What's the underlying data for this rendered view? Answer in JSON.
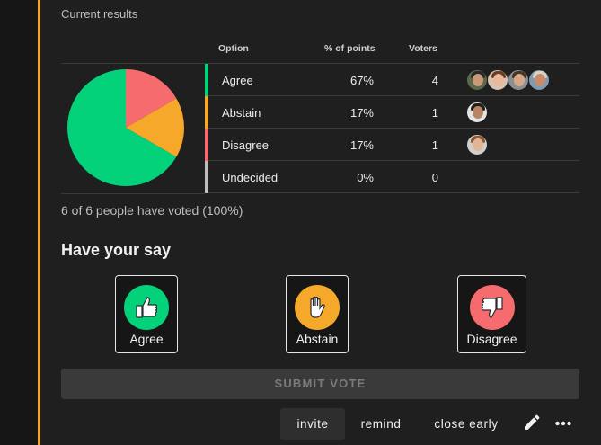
{
  "results": {
    "title": "Current results",
    "headers": {
      "option": "Option",
      "percent": "% of points",
      "voters": "Voters"
    },
    "rows": [
      {
        "option": "Agree",
        "percent": "67%",
        "voters": "4",
        "color": "#04d27b",
        "avatars": 4
      },
      {
        "option": "Abstain",
        "percent": "17%",
        "voters": "1",
        "color": "#f6a82b",
        "avatars": 1
      },
      {
        "option": "Disagree",
        "percent": "17%",
        "voters": "1",
        "color": "#f66b6e",
        "avatars": 1
      },
      {
        "option": "Undecided",
        "percent": "0%",
        "voters": "0",
        "color": "#bdbdbd",
        "avatars": 0
      }
    ],
    "summary": "6 of 6 people have voted (100%)",
    "pie_fractions": [
      0.6667,
      0.1667,
      0.1667
    ]
  },
  "have_your_say": {
    "title": "Have your say",
    "options": [
      {
        "label": "Agree",
        "color": "#04d27b",
        "icon": "thumbs-up-icon"
      },
      {
        "label": "Abstain",
        "color": "#f6a82b",
        "icon": "raised-hand-icon"
      },
      {
        "label": "Disagree",
        "color": "#f66b6e",
        "icon": "thumbs-down-icon"
      }
    ],
    "submit_label": "SUBMIT VOTE"
  },
  "actions": {
    "invite": "invite",
    "remind": "remind",
    "close_early": "close early",
    "edit_icon": "pencil-icon",
    "more_icon": "more-horizontal-icon"
  }
}
